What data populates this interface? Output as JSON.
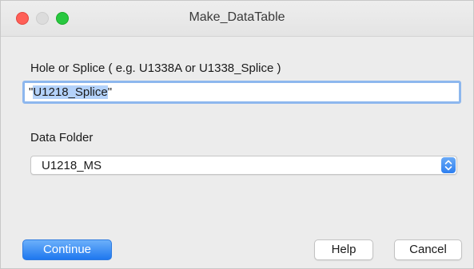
{
  "window": {
    "title": "Make_DataTable"
  },
  "form": {
    "hole_label": "Hole or Splice ( e.g. U1338A or U1338_Splice )",
    "hole_value_prefix": "\"",
    "hole_value_selected": "U1218_Splice",
    "hole_value_suffix": "\"",
    "folder_label": "Data Folder",
    "folder_value": "U1218_MS"
  },
  "buttons": {
    "continue_label": "Continue",
    "help_label": "Help",
    "cancel_label": "Cancel"
  },
  "colors": {
    "default_button": "#1e77ef",
    "focus_ring": "#8db7ee",
    "selection": "#b4d2fa",
    "close_light": "#ff5f57",
    "zoom_light": "#28c840"
  },
  "icons": {
    "close": "close-light",
    "minimize": "minimize-light",
    "zoom": "zoom-light",
    "popup_arrows": "up-down-chevron-icon"
  }
}
